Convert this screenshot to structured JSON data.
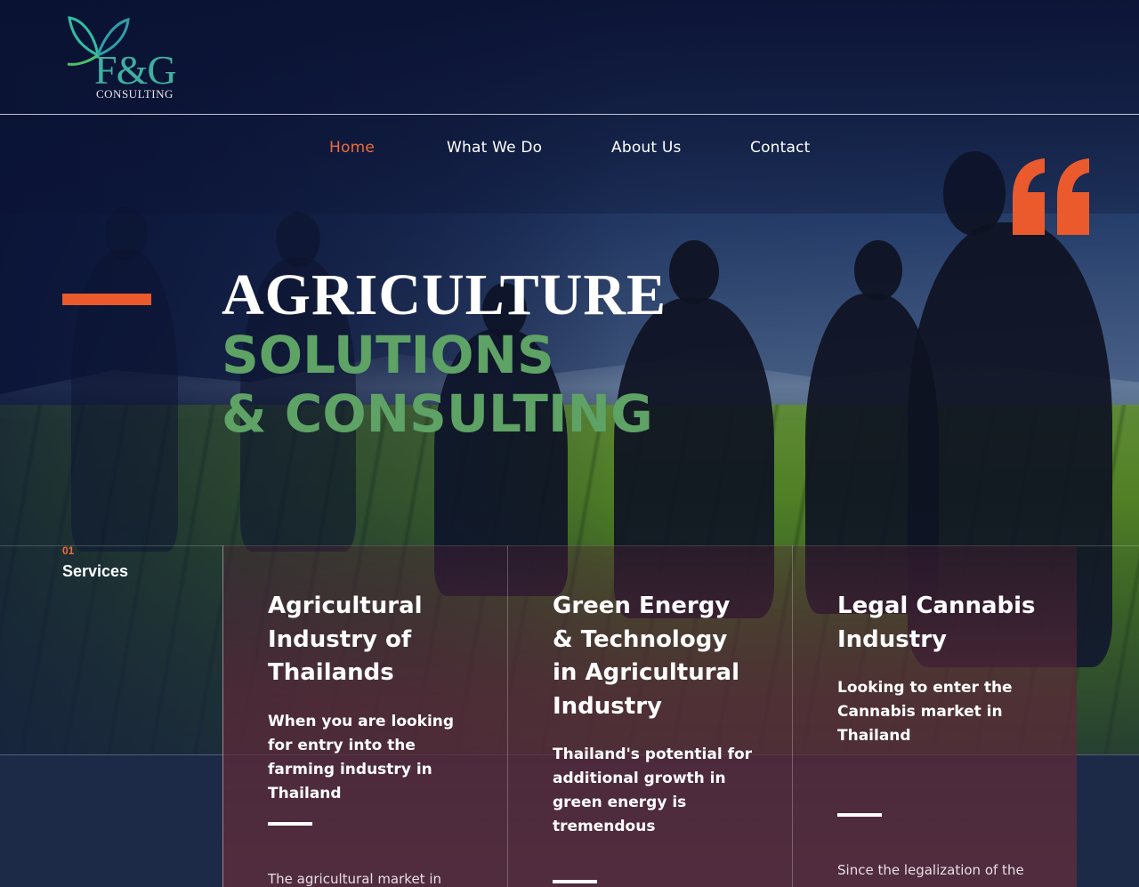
{
  "brand": {
    "logo_main": "F&G",
    "logo_sub": "CONSULTING"
  },
  "nav": {
    "items": [
      {
        "label": "Home",
        "active": true
      },
      {
        "label": "What We Do",
        "active": false
      },
      {
        "label": "About Us",
        "active": false
      },
      {
        "label": "Contact",
        "active": false
      }
    ]
  },
  "hero": {
    "line1": "AGRICULTURE",
    "line2": "SOLUTIONS",
    "line3": "& CONSULTING"
  },
  "services": {
    "number": "01",
    "label": "Services",
    "cards": [
      {
        "title": "Agricultural Industry of Thailands",
        "subtitle": "When you are looking for entry into the farming industry in Thailand",
        "body": "The agricultural market in"
      },
      {
        "title": "Green Energy & Technology in Agricultural Industry",
        "subtitle": "Thailand's potential for additional growth in green energy is tremendous",
        "body": ""
      },
      {
        "title": "Legal Cannabis Industry",
        "subtitle": "Looking to enter the Cannabis market in Thailand",
        "body": "Since the legalization of the"
      }
    ]
  },
  "colors": {
    "accent": "#ea5a2c",
    "nav_active": "#f06a3b",
    "headline_green": "#5ea266",
    "logo_teal": "#3fb0a0"
  },
  "icons": {
    "quote": "quote-icon",
    "logo_butterfly": "butterfly-icon"
  }
}
